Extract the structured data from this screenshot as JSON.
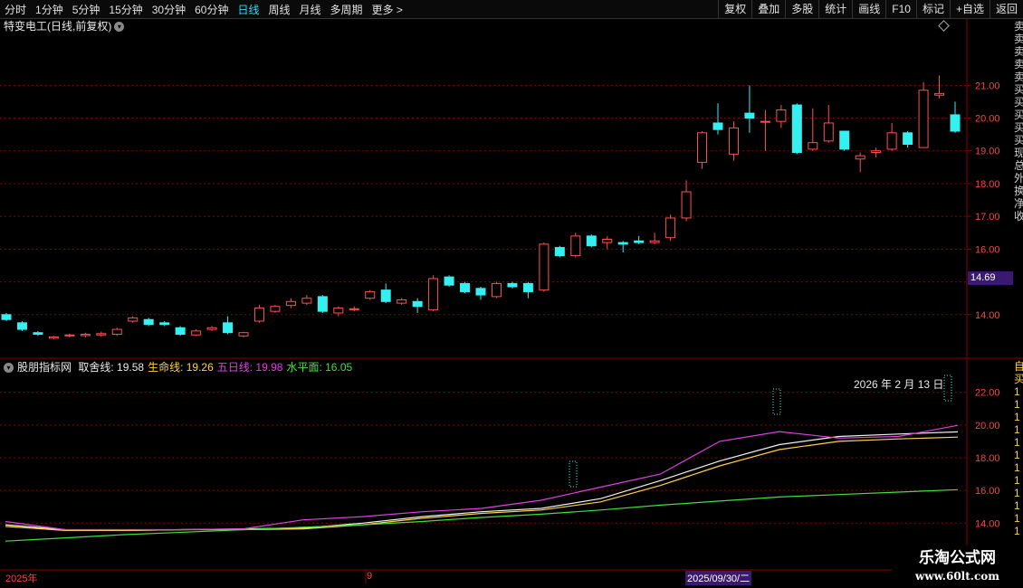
{
  "toolbar": {
    "periods": [
      "分时",
      "1分钟",
      "5分钟",
      "15分钟",
      "30分钟",
      "60分钟",
      "日线",
      "周线",
      "月线",
      "多周期",
      "更多 >"
    ],
    "active_period": "日线",
    "right_buttons": [
      "复权",
      "叠加",
      "多股",
      "统计",
      "画线",
      "F10",
      "标记",
      "+自选",
      "返回"
    ]
  },
  "stock": {
    "title": "特变电工(日线,前复权)",
    "current_price_tag": "14.69"
  },
  "price_axis": {
    "ticks": [
      "21.00",
      "20.00",
      "19.00",
      "18.00",
      "17.00",
      "16.00",
      "14.00"
    ]
  },
  "indicator": {
    "name": "股朋指标网",
    "items": [
      {
        "label": "取舍线:",
        "value": "19.58",
        "color": "#e8e8e8"
      },
      {
        "label": "生命线:",
        "value": "19.26",
        "color": "#ffd23c"
      },
      {
        "label": "五日线:",
        "value": "19.98",
        "color": "#e040e0"
      },
      {
        "label": "水平面:",
        "value": "16.05",
        "color": "#40e040"
      }
    ],
    "date_label": "2026 年 2 月 13 日",
    "axis_ticks": [
      "22.00",
      "20.00",
      "18.00",
      "16.00",
      "14.00"
    ]
  },
  "time_axis": {
    "labels": [
      "2025年",
      "9"
    ],
    "cursor_label": "2025/09/30/二"
  },
  "watermark": {
    "line1": "乐淘公式网",
    "line2": "www.60lt.com"
  },
  "right_strip_text": [
    "卖",
    "卖",
    "卖",
    "卖",
    "卖",
    "买",
    "买",
    "买",
    "买",
    "买",
    "现",
    "总",
    "外",
    "换",
    "净",
    "收"
  ],
  "right_strip2_text": [
    "自",
    "买",
    "1",
    "1",
    "1",
    "1",
    "1",
    "1",
    "1",
    "1",
    "1",
    "1",
    "1",
    "1"
  ],
  "colors": {
    "up": "#ff5050",
    "down": "#35f0f0",
    "grid": "#8a0000",
    "ma_white": "#f0f0f0",
    "ma_yellow": "#ffd23c",
    "ma_magenta": "#e040e0",
    "ma_green": "#30d030",
    "active": "#35d4ff"
  },
  "chart_data": {
    "type": "candlestick",
    "ylim": [
      13,
      22.5
    ],
    "candles": [
      [
        14.0,
        13.85,
        14.05,
        13.8
      ],
      [
        13.75,
        13.55,
        13.8,
        13.5
      ],
      [
        13.45,
        13.4,
        13.5,
        13.35
      ],
      [
        13.28,
        13.32,
        13.35,
        13.25
      ],
      [
        13.35,
        13.38,
        13.42,
        13.3
      ],
      [
        13.36,
        13.4,
        13.45,
        13.3
      ],
      [
        13.38,
        13.42,
        13.48,
        13.32
      ],
      [
        13.4,
        13.55,
        13.6,
        13.35
      ],
      [
        13.8,
        13.9,
        13.95,
        13.75
      ],
      [
        13.85,
        13.7,
        13.9,
        13.65
      ],
      [
        13.75,
        13.7,
        13.8,
        13.65
      ],
      [
        13.6,
        13.4,
        13.65,
        13.35
      ],
      [
        13.38,
        13.5,
        13.55,
        13.35
      ],
      [
        13.55,
        13.6,
        13.65,
        13.5
      ],
      [
        13.75,
        13.45,
        13.95,
        13.4
      ],
      [
        13.35,
        13.45,
        13.48,
        13.3
      ],
      [
        13.8,
        14.2,
        14.3,
        13.75
      ],
      [
        14.1,
        14.25,
        14.3,
        14.05
      ],
      [
        14.28,
        14.4,
        14.5,
        14.2
      ],
      [
        14.35,
        14.5,
        14.6,
        14.3
      ],
      [
        14.55,
        14.1,
        14.6,
        14.05
      ],
      [
        14.05,
        14.2,
        14.25,
        13.95
      ],
      [
        14.15,
        14.18,
        14.25,
        14.1
      ],
      [
        14.5,
        14.7,
        14.75,
        14.45
      ],
      [
        14.75,
        14.4,
        14.95,
        14.35
      ],
      [
        14.35,
        14.45,
        14.5,
        14.3
      ],
      [
        14.4,
        14.25,
        14.5,
        14.05
      ],
      [
        14.15,
        15.1,
        15.2,
        14.1
      ],
      [
        15.15,
        14.9,
        15.2,
        14.85
      ],
      [
        14.95,
        14.7,
        15.0,
        14.65
      ],
      [
        14.8,
        14.6,
        14.85,
        14.45
      ],
      [
        14.55,
        14.95,
        15.0,
        14.5
      ],
      [
        14.95,
        14.85,
        15.0,
        14.8
      ],
      [
        14.95,
        14.7,
        15.0,
        14.5
      ],
      [
        14.75,
        16.15,
        16.2,
        14.7
      ],
      [
        16.05,
        15.8,
        16.1,
        15.75
      ],
      [
        15.8,
        16.4,
        16.5,
        15.75
      ],
      [
        16.4,
        16.1,
        16.45,
        16.05
      ],
      [
        16.2,
        16.3,
        16.4,
        16.0
      ],
      [
        16.2,
        16.15,
        16.25,
        15.9
      ],
      [
        16.25,
        16.2,
        16.4,
        16.15
      ],
      [
        16.2,
        16.25,
        16.5,
        16.15
      ],
      [
        16.35,
        16.95,
        17.05,
        16.25
      ],
      [
        16.95,
        17.75,
        18.1,
        16.85
      ],
      [
        18.65,
        19.55,
        19.6,
        18.45
      ],
      [
        19.85,
        19.65,
        20.45,
        19.5
      ],
      [
        18.9,
        19.7,
        19.9,
        18.7
      ],
      [
        20.15,
        20.0,
        21.0,
        19.55
      ],
      [
        19.9,
        19.9,
        20.25,
        19.0
      ],
      [
        19.9,
        20.25,
        20.4,
        19.7
      ],
      [
        20.4,
        18.95,
        20.45,
        18.9
      ],
      [
        19.05,
        19.25,
        20.3,
        19.0
      ],
      [
        19.3,
        19.85,
        20.4,
        19.25
      ],
      [
        19.6,
        19.05,
        19.6,
        19.0
      ],
      [
        18.75,
        18.85,
        18.95,
        18.35
      ],
      [
        18.95,
        19.0,
        19.1,
        18.8
      ],
      [
        19.05,
        19.55,
        19.85,
        19.0
      ],
      [
        19.55,
        19.2,
        19.6,
        19.1
      ],
      [
        19.1,
        20.85,
        21.1,
        19.1
      ],
      [
        20.7,
        20.75,
        21.3,
        20.6
      ],
      [
        20.1,
        19.6,
        20.5,
        19.55
      ]
    ],
    "indicator_ylim": [
      12.8,
      23.2
    ],
    "indicator_series": [
      {
        "name": "取舍线",
        "color": "#f0f0f0",
        "values": [
          13.9,
          13.6,
          13.55,
          13.6,
          13.65,
          13.7,
          14.0,
          14.4,
          14.7,
          14.9,
          15.5,
          16.6,
          17.8,
          18.8,
          19.3,
          19.45,
          19.58
        ]
      },
      {
        "name": "生命线",
        "color": "#ffd23c",
        "values": [
          13.8,
          13.55,
          13.55,
          13.6,
          13.6,
          13.65,
          13.9,
          14.3,
          14.6,
          14.8,
          15.3,
          16.3,
          17.5,
          18.5,
          19.0,
          19.15,
          19.26
        ]
      },
      {
        "name": "五日线",
        "color": "#e040e0",
        "values": [
          14.1,
          13.6,
          13.6,
          13.6,
          13.65,
          14.2,
          14.4,
          14.7,
          14.9,
          15.4,
          16.2,
          17.0,
          19.0,
          19.6,
          19.2,
          19.3,
          19.98
        ]
      },
      {
        "name": "水平面",
        "color": "#40e040",
        "values": [
          12.9,
          13.1,
          13.3,
          13.45,
          13.6,
          13.75,
          13.9,
          14.1,
          14.35,
          14.55,
          14.8,
          15.1,
          15.35,
          15.6,
          15.75,
          15.9,
          16.05
        ]
      }
    ]
  }
}
